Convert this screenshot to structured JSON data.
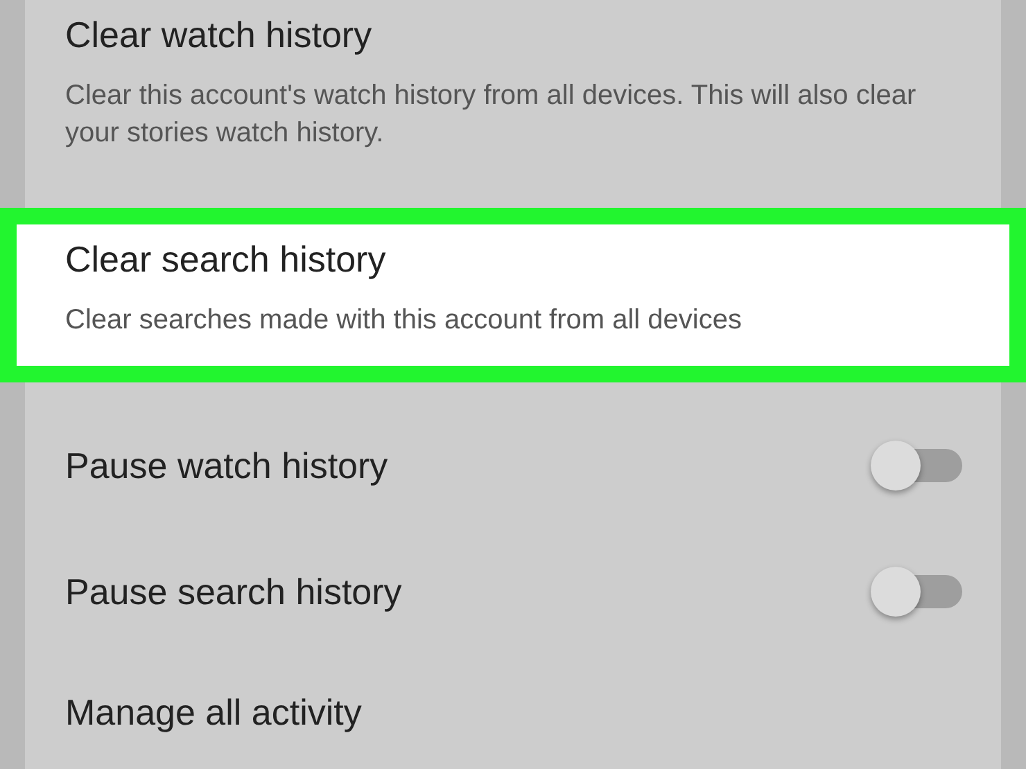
{
  "items": [
    {
      "kind": "action",
      "title": "Clear watch history",
      "description": "Clear this account's watch history from all devices. This will also clear your stories watch history.",
      "highlighted": false
    },
    {
      "kind": "action",
      "title": "Clear search history",
      "description": "Clear searches made with this account from all devices",
      "highlighted": true
    },
    {
      "kind": "toggle",
      "title": "Pause watch history",
      "on": false
    },
    {
      "kind": "toggle",
      "title": "Pause search history",
      "on": false
    },
    {
      "kind": "action",
      "title": "Manage all activity",
      "highlighted": false
    }
  ]
}
